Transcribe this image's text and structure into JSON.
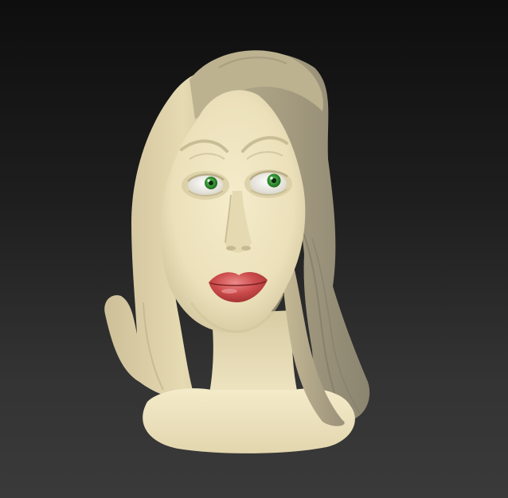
{
  "viewport": {
    "background_top": "#0e0e0e",
    "background_bottom": "#3a3a3a"
  },
  "model": {
    "subject": "sculpted-female-head-bust",
    "colors": {
      "skin": "#ede3bd",
      "skin_shadow": "#cfc39a",
      "hair_light": "#d9cea7",
      "hair_dark": "#9c9379",
      "lips": "#c94a4a",
      "iris": "#3a9a3a",
      "sclera": "#f3f1ea"
    }
  }
}
